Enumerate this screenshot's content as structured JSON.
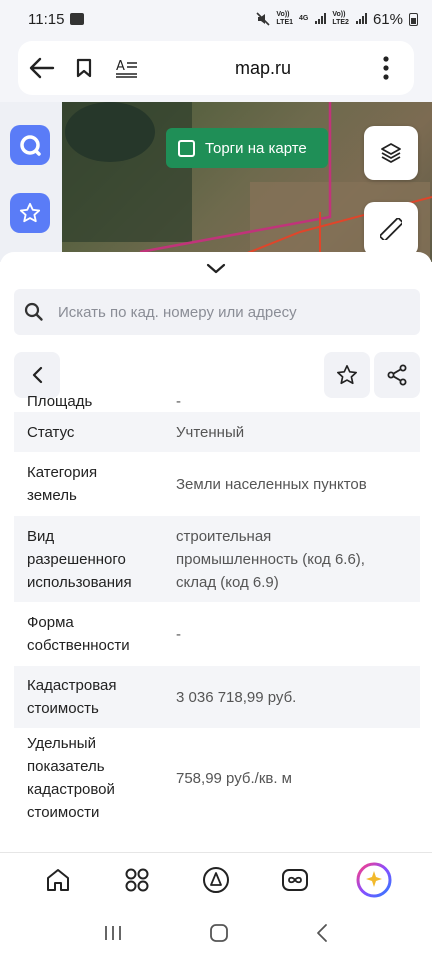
{
  "status_bar": {
    "time": "11:15",
    "net1_top": "Vo))",
    "net1_bottom": "LTE1",
    "net_type": "4G",
    "net2_top": "Vo))",
    "net2_bottom": "LTE2",
    "battery": "61%"
  },
  "browser": {
    "url": "map.ru",
    "icons": [
      "back-arrow-icon",
      "bookmark-icon",
      "reader-mode-icon",
      "more-vert-icon"
    ]
  },
  "map": {
    "torgi_label": "Торги на карте",
    "colors": {
      "torgi_bg": "#1f8f57",
      "side_button": "#5a7cf7",
      "boundary_pink": "#c0347a",
      "boundary_red": "#e0452a"
    }
  },
  "panel": {
    "search_placeholder": "Искать по кад. номеру или адресу",
    "rows": [
      {
        "key": [
          "Площадь"
        ],
        "value": [
          "-"
        ]
      },
      {
        "key": [
          "Статус"
        ],
        "value": [
          "Учтенный"
        ]
      },
      {
        "key": [
          "Категория",
          "земель"
        ],
        "value": [
          "Земли населенных пунктов"
        ]
      },
      {
        "key": [
          "Вид",
          "разрешенного",
          "использования"
        ],
        "value": [
          "строительная",
          "промышленность (код 6.6),",
          "склад (код 6.9)"
        ]
      },
      {
        "key": [
          "Форма",
          "собственности"
        ],
        "value": [
          "-"
        ]
      },
      {
        "key": [
          "Кадастровая",
          "стоимость"
        ],
        "value": [
          "3 036 718,99 руб."
        ]
      },
      {
        "key": [
          "Удельный",
          "показатель",
          "кадастровой",
          "стоимости"
        ],
        "value": [
          "758,99 руб./кв. м"
        ]
      }
    ]
  }
}
